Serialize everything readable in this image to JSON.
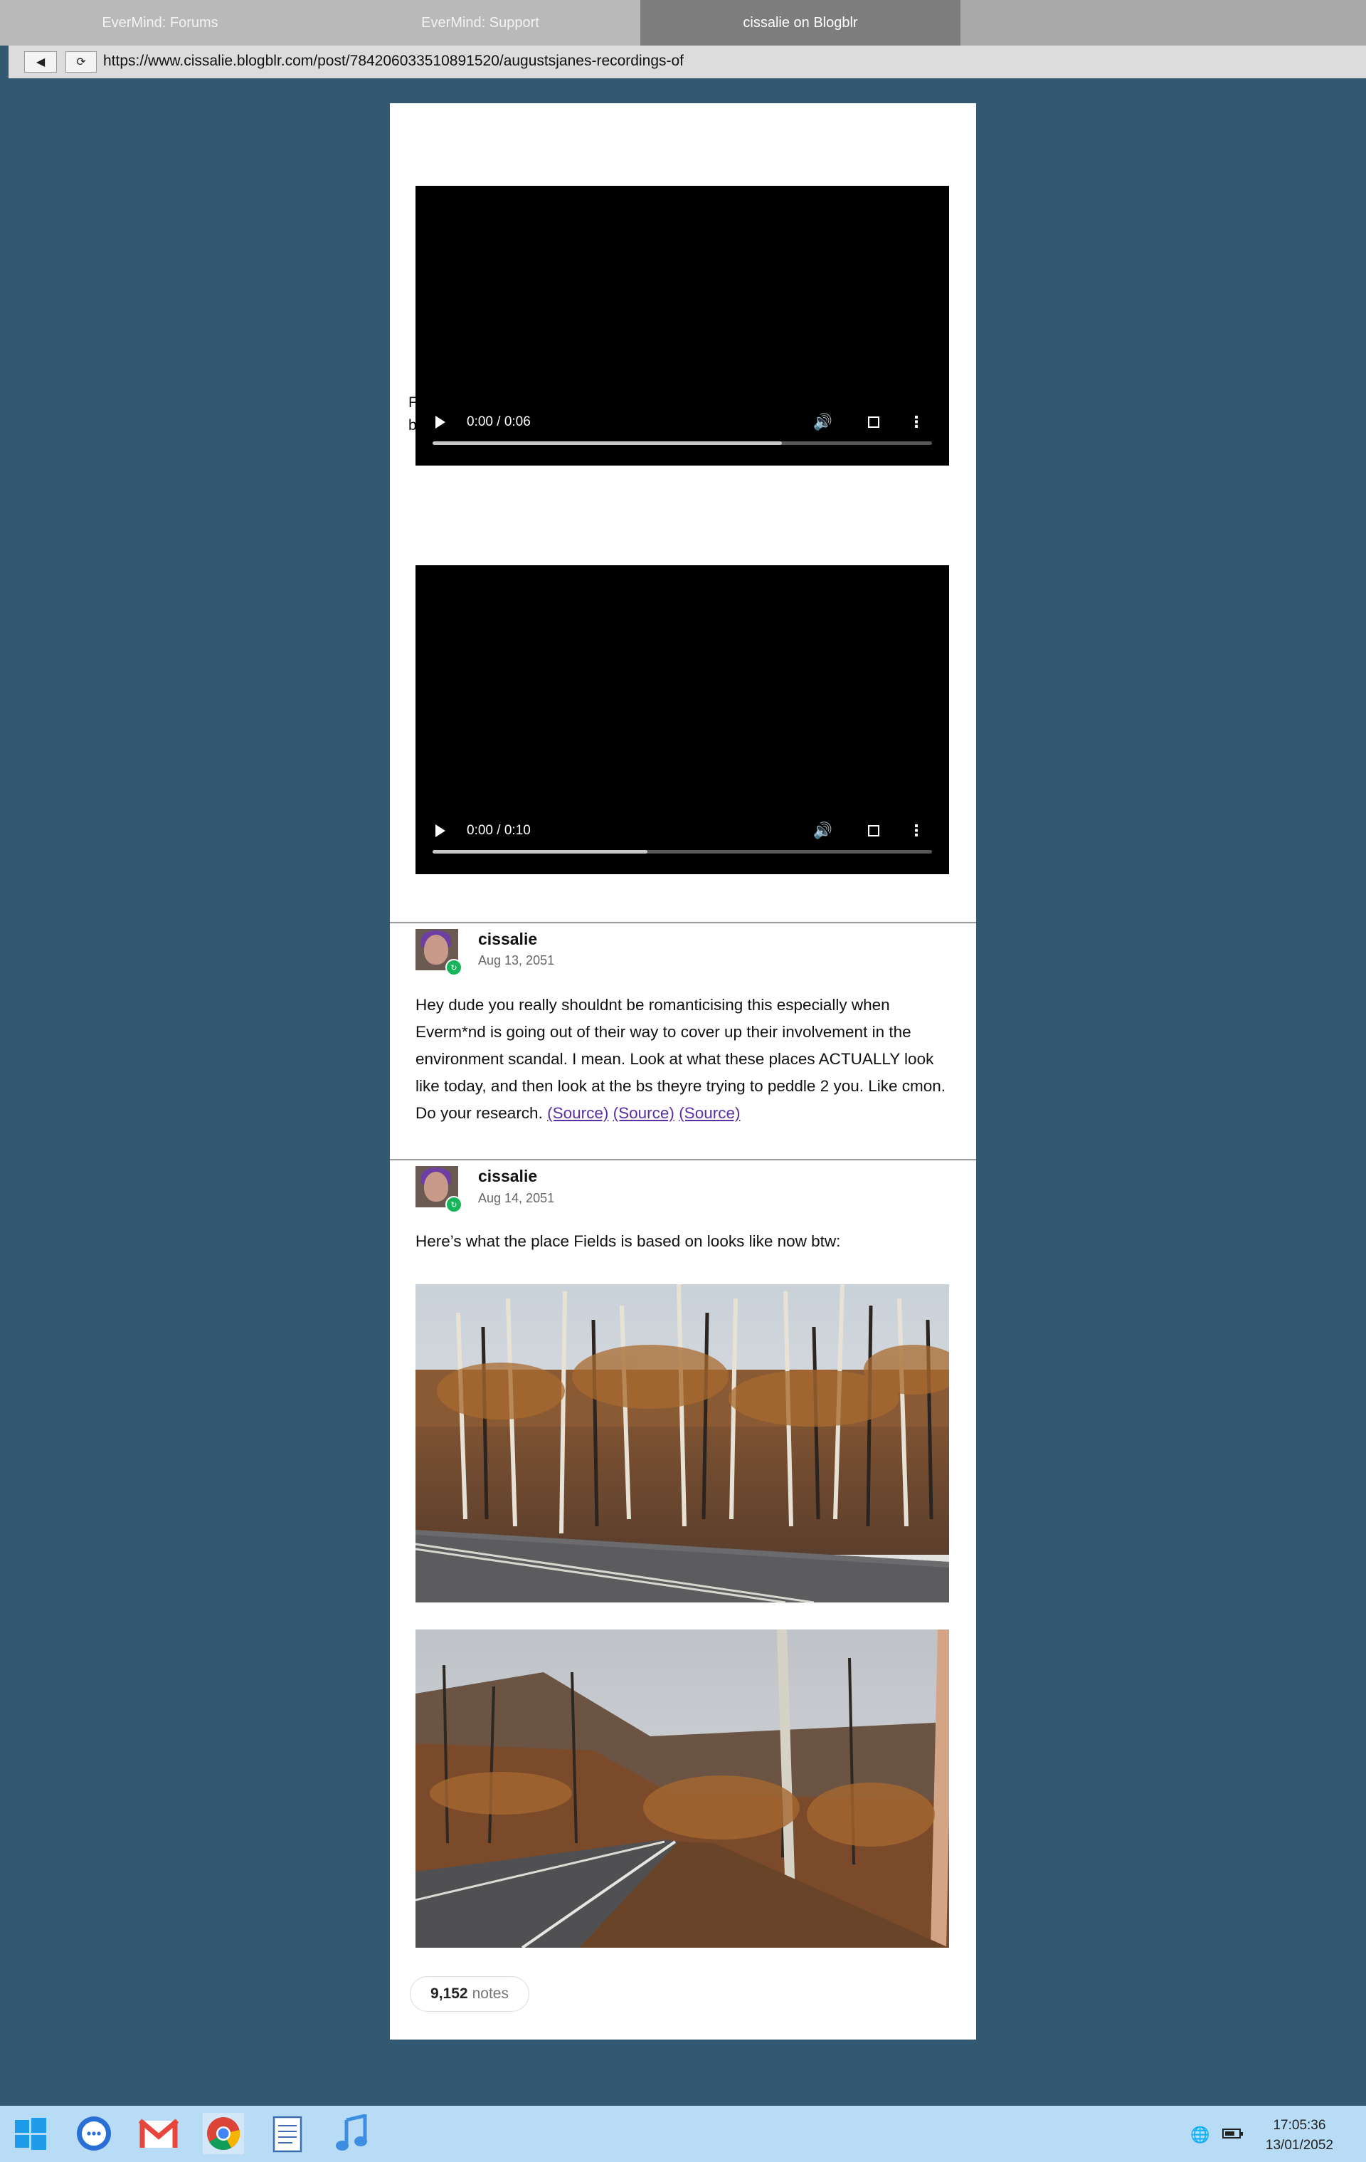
{
  "browser": {
    "tabs": [
      {
        "label": "EverMind: Forums",
        "active": false
      },
      {
        "label": "EverMind: Support",
        "active": false
      },
      {
        "label": "cissalie on Blogblr",
        "active": true
      }
    ],
    "url": "https://www.cissalie.blogblr.com/post/784206033510891520/augustsjanes-recordings-of",
    "back_icon": "◀",
    "reload_icon": "⟳"
  },
  "post": {
    "hidden_caption": "F\nbrief vid of EverMind's Fields of Aster (below). Enjoy (:^)",
    "videos": [
      {
        "time": "0:00 / 0:06",
        "buffered": 0.7
      },
      {
        "time": "0:00 / 0:10",
        "buffered": 0.43
      }
    ],
    "replies": [
      {
        "username": "cissalie",
        "date": "Aug 13, 2051",
        "text": "Hey dude you really shouldnt be romanticising this especially when Everm*nd is going out of their way to cover up their involvement in the environment scandal. I mean. Look at what these places ACTUALLY look like today, and then look at the bs theyre trying to peddle 2 you. Like cmon. Do your research.",
        "links": [
          "(Source)",
          "(Source)",
          "(Source)"
        ]
      },
      {
        "username": "cissalie",
        "date": "Aug 14, 2051",
        "text": "Here’s what the place Fields is based on looks like now btw:"
      }
    ],
    "notes_count": "9,152",
    "notes_label": "notes"
  },
  "taskbar": {
    "time": "17:05:36",
    "date": "13/01/2052",
    "apps": [
      "windows-start",
      "messages",
      "gmail",
      "chrome",
      "notes",
      "music"
    ]
  }
}
